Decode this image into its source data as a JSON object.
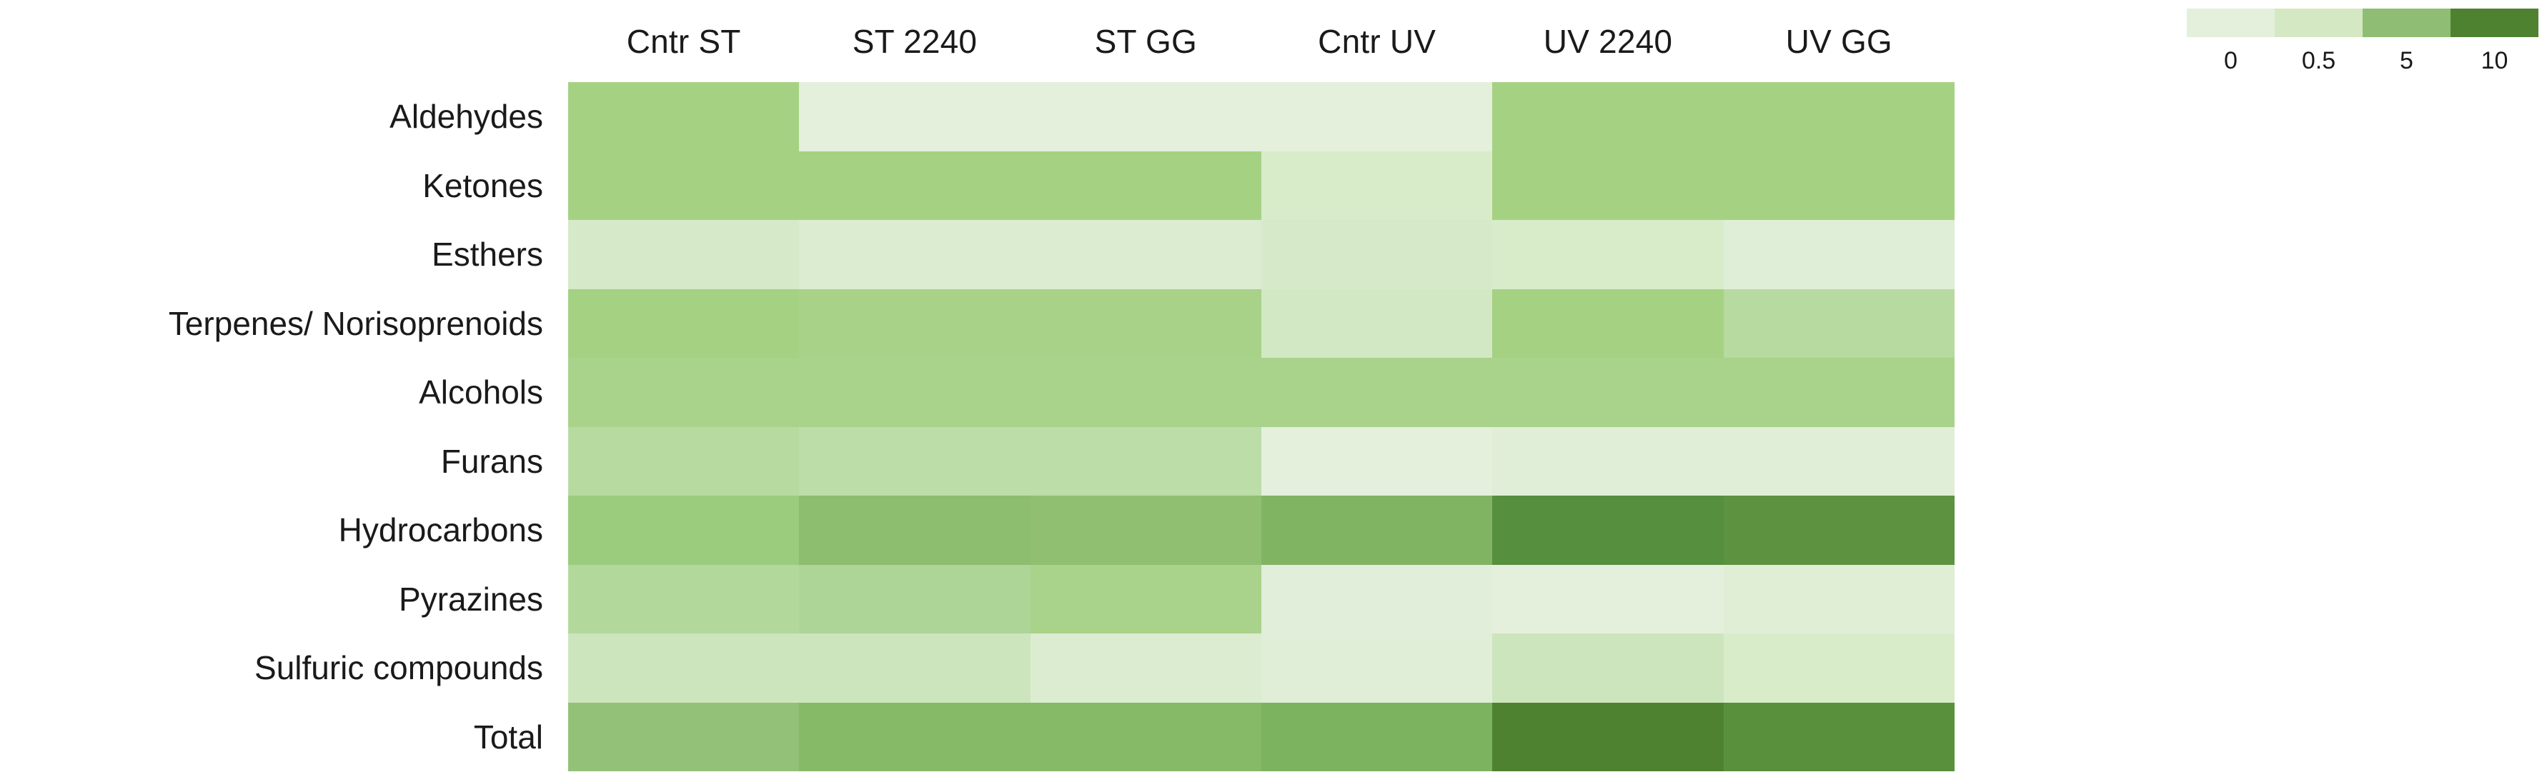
{
  "legend": {
    "name": "color-scale-legend",
    "swatch_colors": [
      "#e4efdc",
      "#d4e8c4",
      "#90bd74",
      "#4f8230"
    ],
    "labels": [
      "0",
      "0.5",
      "5",
      "10"
    ]
  },
  "chart_data": {
    "type": "heatmap",
    "title": "",
    "xlabel": "",
    "ylabel": "",
    "grid": false,
    "legend_position": "top-right",
    "colorscale": {
      "type": "binned-sequential-green",
      "bins": [
        {
          "label": "0",
          "color": "#e4efdc"
        },
        {
          "label": "0.5",
          "color": "#d4e8c4"
        },
        {
          "label": "5",
          "color": "#90bd74"
        },
        {
          "label": "10",
          "color": "#4f8230"
        }
      ]
    },
    "categories": [
      "Cntr ST",
      "ST 2240",
      "ST GG",
      "Cntr UV",
      "UV 2240",
      "UV GG"
    ],
    "rows": [
      "Aldehydes",
      "Ketones",
      "Esthers",
      "Terpenes/ Norisoprenoids",
      "Alcohols",
      "Furans",
      "Hydrocarbons",
      "Pyrazines",
      "Sulfuric compounds",
      "Total"
    ],
    "values": [
      [
        5.0,
        0.4,
        0.4,
        0.4,
        5.0,
        5.0
      ],
      [
        5.0,
        5.0,
        5.0,
        0.6,
        5.0,
        5.0
      ],
      [
        0.8,
        0.6,
        0.7,
        0.9,
        0.8,
        0.5
      ],
      [
        4.5,
        4.6,
        4.6,
        0.8,
        4.4,
        3.2
      ],
      [
        4.6,
        4.6,
        4.6,
        4.6,
        4.6,
        4.6
      ],
      [
        3.0,
        3.1,
        3.0,
        0.4,
        0.6,
        0.5
      ],
      [
        5.5,
        6.5,
        6.2,
        6.8,
        10.0,
        9.6
      ],
      [
        3.2,
        3.6,
        4.2,
        0.5,
        0.4,
        0.7
      ],
      [
        1.0,
        1.1,
        0.6,
        0.5,
        1.0,
        0.7
      ],
      [
        6.0,
        6.8,
        6.8,
        6.7,
        10.0,
        9.8
      ]
    ],
    "cell_colors": [
      [
        "#a5d183",
        "#e4efdc",
        "#e4efdc",
        "#e4efdc",
        "#a5d183",
        "#a5d183"
      ],
      [
        "#a5d183",
        "#a5d183",
        "#a5d183",
        "#d9ecca",
        "#a5d183",
        "#a5d183"
      ],
      [
        "#d6e9c9",
        "#dcecd1",
        "#dcecd1",
        "#d6e9c9",
        "#d9ecca",
        "#dfeed6"
      ],
      [
        "#a5d183",
        "#a8d288",
        "#a8d288",
        "#d2e8c4",
        "#a5d183",
        "#b7daa1"
      ],
      [
        "#a9d28a",
        "#a9d28a",
        "#a9d28a",
        "#a9d28a",
        "#a9d28a",
        "#a9d28a"
      ],
      [
        "#b7daa1",
        "#bcdda7",
        "#bcdda7",
        "#e4efdc",
        "#e0eed7",
        "#e0eed7"
      ],
      [
        "#9bcb7d",
        "#8dbd6e",
        "#90bf71",
        "#80b462",
        "#568f3e",
        "#5d9241"
      ],
      [
        "#b3d89c",
        "#aed598",
        "#a9d28a",
        "#e1eeda",
        "#e4efdc",
        "#dfeed5"
      ],
      [
        "#cde5bd",
        "#cde5bd",
        "#dcecd1",
        "#e0eed8",
        "#cde5bd",
        "#d9ecca"
      ],
      [
        "#93c177",
        "#86ba67",
        "#86ba67",
        "#7bb35f",
        "#4f8230",
        "#59903c"
      ]
    ]
  }
}
